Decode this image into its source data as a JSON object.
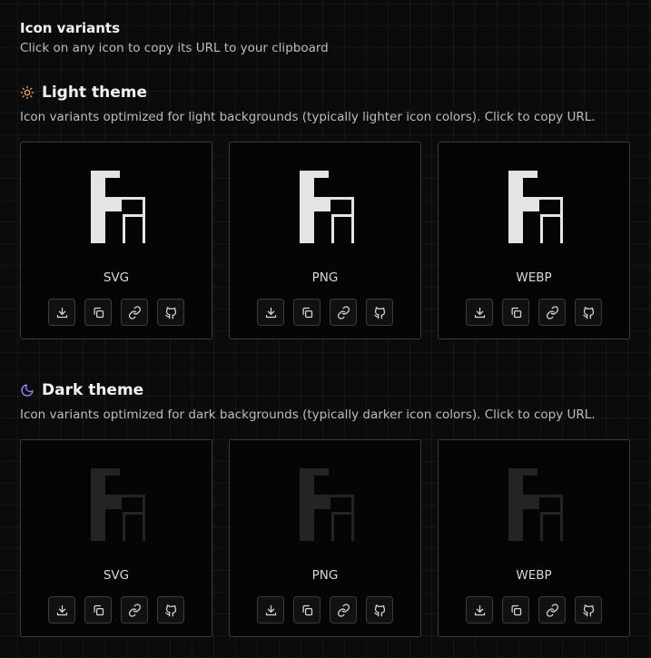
{
  "header": {
    "title": "Icon variants",
    "subtitle": "Click on any icon to copy its URL to your clipboard"
  },
  "sections": [
    {
      "id": "light",
      "icon": "sun-icon",
      "icon_color": "#f5a34a",
      "title": "Light theme",
      "description": "Icon variants optimized for light backgrounds (typically lighter icon colors). Click to copy URL.",
      "logo_color": "#e4e4e4",
      "cards": [
        {
          "format": "SVG"
        },
        {
          "format": "PNG"
        },
        {
          "format": "WEBP"
        }
      ]
    },
    {
      "id": "dark",
      "icon": "moon-icon",
      "icon_color": "#8b8cf6",
      "title": "Dark theme",
      "description": "Icon variants optimized for dark backgrounds (typically darker icon colors). Click to copy URL.",
      "logo_color": "#242424",
      "cards": [
        {
          "format": "SVG"
        },
        {
          "format": "PNG"
        },
        {
          "format": "WEBP"
        }
      ]
    }
  ],
  "actions": [
    "download-icon",
    "copy-icon",
    "link-icon",
    "github-icon"
  ]
}
